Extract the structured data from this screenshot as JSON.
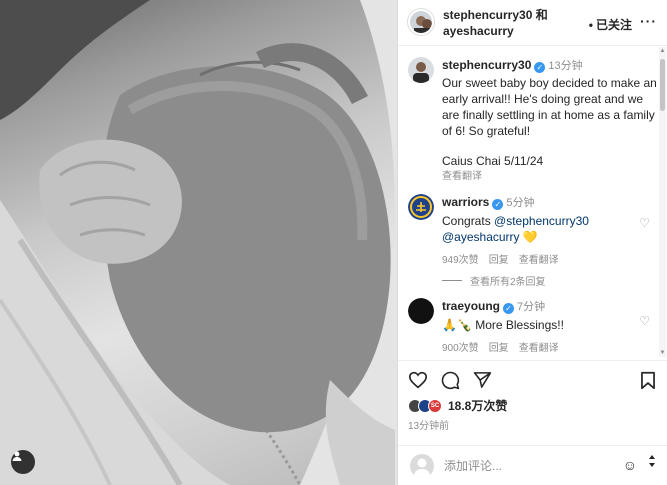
{
  "header": {
    "username_line1": "stephencurry30 和",
    "username_line2": "ayeshacurry",
    "follow_label": "已关注",
    "more_label": "···"
  },
  "caption": {
    "username": "stephencurry30",
    "time": "13分钟",
    "text": "Our sweet baby boy decided to make an early arrival!! He's doing great and we are finally settling in at home as a family of 6! So grateful!",
    "signature": "Caius Chai 5/11/24",
    "translate": "查看翻译"
  },
  "comments": [
    {
      "username": "warriors",
      "time": "5分钟",
      "mention1": "@stephencurry30",
      "mention2": "@ayeshacurry",
      "emoji": "💛",
      "likes": "949次赞",
      "reply": "回复",
      "translate": "查看翻译",
      "view_replies": "查看所有2条回复"
    },
    {
      "username": "traeyoung",
      "time": "7分钟",
      "text": "🙏🍾 More Blessings!!",
      "likes": "900次赞",
      "reply": "回复",
      "translate": "查看翻译"
    }
  ],
  "post": {
    "likes": "18.8万次赞",
    "posted": "13分钟前"
  },
  "add_comment": {
    "placeholder": "添加评论..."
  },
  "icons": {
    "like": "heart-icon",
    "comment": "comment-icon",
    "share": "send-icon",
    "save": "bookmark-icon",
    "user_tag": "user-tag-icon",
    "emoji": "emoji-icon"
  },
  "colors": {
    "verified": "#3897f0",
    "warriors_blue": "#1d428a",
    "warriors_gold": "#ffc72c",
    "mention": "#00376b",
    "muted": "#8e8e8e"
  }
}
